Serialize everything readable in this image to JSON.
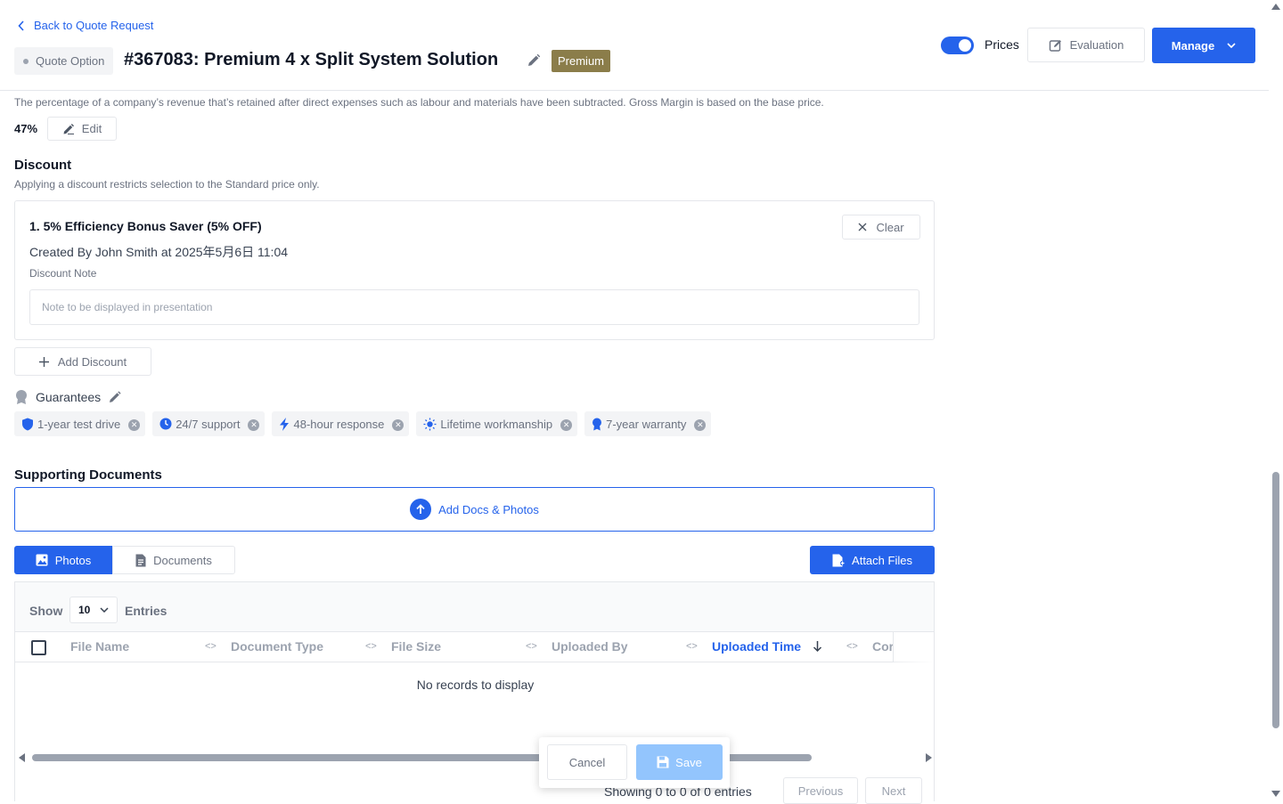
{
  "header": {
    "back_label": "Back to Quote Request",
    "quote_option_label": "Quote Option",
    "title": "#367083: Premium 4 x Split System Solution",
    "badge": "Premium",
    "prices_label": "Prices",
    "prices_toggle_on": true,
    "evaluation_label": "Evaluation",
    "manage_label": "Manage"
  },
  "gross_margin": {
    "description": "The percentage of a company’s revenue that’s retained after direct expenses such as labour and materials have been subtracted. Gross Margin is based on the base price.",
    "value": "47%",
    "edit_label": "Edit"
  },
  "discount": {
    "title": "Discount",
    "subtitle": "Applying a discount restricts selection to the Standard price only.",
    "item_name": "1. 5% Efficiency Bonus Saver (5% OFF)",
    "created_by": "Created By John Smith at 2025年5月6日 11:04",
    "note_label": "Discount Note",
    "note_placeholder": "Note to be displayed in presentation",
    "clear_label": "Clear",
    "add_label": "Add Discount"
  },
  "guarantees": {
    "title": "Guarantees",
    "items": [
      {
        "label": "1-year test drive",
        "icon": "shield-icon"
      },
      {
        "label": "24/7 support",
        "icon": "clock-icon"
      },
      {
        "label": "48-hour response",
        "icon": "lightning-icon"
      },
      {
        "label": "Lifetime workmanship",
        "icon": "sun-icon"
      },
      {
        "label": "7-year warranty",
        "icon": "award-icon"
      }
    ]
  },
  "supporting_documents": {
    "title": "Supporting Documents",
    "upload_label": "Add Docs & Photos",
    "tabs": [
      "Photos",
      "Documents"
    ],
    "attach_label": "Attach Files",
    "show_label": "Show",
    "page_size": "10",
    "entries_label": "Entries",
    "columns": [
      "File Name",
      "Document Type",
      "File Size",
      "Uploaded By",
      "Uploaded Time",
      "Cor"
    ],
    "sorted_column": "Uploaded Time",
    "empty_text": "No records to display",
    "showing_text": "Showing 0 to 0 of 0 entries",
    "prev_label": "Previous",
    "next_label": "Next"
  },
  "footer_bar": {
    "cancel_label": "Cancel",
    "save_label": "Save"
  },
  "colors": {
    "accent": "#2563eb",
    "premium_badge": "#8b7d4a",
    "save_disabled": "#93c5fd"
  }
}
